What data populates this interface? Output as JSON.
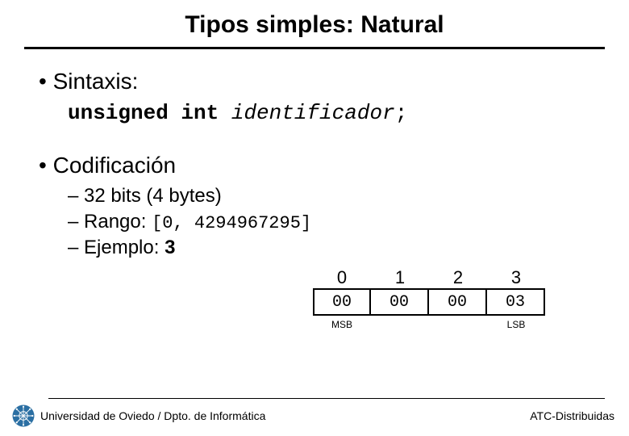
{
  "title": "Tipos simples: Natural",
  "bullets": {
    "syntax_label": "Sintaxis:",
    "coding_label": "Codificación"
  },
  "code": {
    "keyword": "unsigned int",
    "ident": "identificador",
    "semicolon": ";"
  },
  "subs": {
    "bits": "32 bits (4 bytes)",
    "range_label": "Rango: ",
    "range_val": "[0, 4294967295]",
    "example_label": "Ejemplo: ",
    "example_val": "3"
  },
  "table": {
    "indices": [
      "0",
      "1",
      "2",
      "3"
    ],
    "bytes": [
      "00",
      "00",
      "00",
      "03"
    ],
    "msb": "MSB",
    "lsb": "LSB"
  },
  "footer": {
    "left": "Universidad de Oviedo / Dpto. de Informática",
    "right": "ATC-Distribuidas"
  },
  "logo_color": "#2b6fa3"
}
